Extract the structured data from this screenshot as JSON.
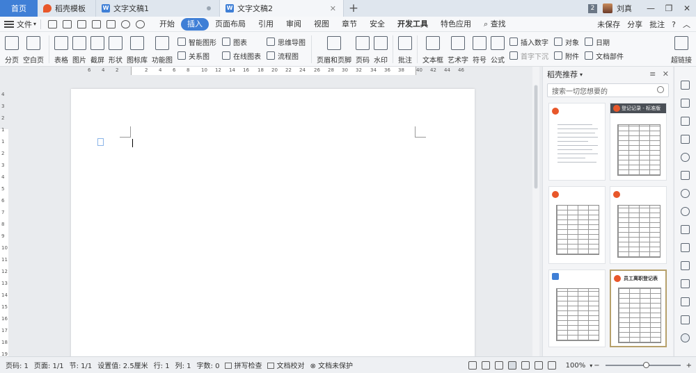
{
  "titlebar": {
    "home_tab": "首页",
    "tabs": [
      {
        "label": "稻壳模板"
      },
      {
        "label": "文字文稿1"
      },
      {
        "label": "文字文稿2"
      }
    ],
    "new_tab": "+",
    "badge": "2",
    "user_name": "刘真"
  },
  "menubar": {
    "file": "文件",
    "items": [
      "开始",
      "插入",
      "页面布局",
      "引用",
      "审阅",
      "视图",
      "章节",
      "安全",
      "开发工具",
      "特色应用",
      "查找"
    ],
    "active": "插入",
    "right": {
      "unsaved": "未保存",
      "share": "分享",
      "comment": "批注",
      "help": "?"
    }
  },
  "ribbon": {
    "page_break": "分页",
    "blank_page": "空白页",
    "table": "表格",
    "picture": "图片",
    "screenshot": "截屏",
    "shape": "形状",
    "icon_lib": "图标库",
    "func_chart": "功能图",
    "smart_shape": "智能图形",
    "chart": "图表",
    "mind_map": "思维导图",
    "relation": "关系图",
    "online_chart": "在线图表",
    "flowchart": "流程图",
    "header_footer": "页眉和页脚",
    "page_num": "页码",
    "watermark": "水印",
    "comment": "批注",
    "text_box": "文本框",
    "word_art": "艺术字",
    "symbol": "符号",
    "formula": "公式",
    "insert_number": "插入数字",
    "object": "对象",
    "date": "日期",
    "drop_cap": "首字下沉",
    "attachment": "附件",
    "doc_parts": "文档部件",
    "hyperlink": "超链接"
  },
  "ruler": {
    "h_ticks": [
      "6",
      "4",
      "2",
      "2",
      "4",
      "6",
      "8",
      "10",
      "12",
      "14",
      "16",
      "18",
      "20",
      "22",
      "24",
      "26",
      "28",
      "30",
      "32",
      "34",
      "36",
      "38",
      "40",
      "42",
      "44",
      "46"
    ],
    "v_ticks": [
      "4",
      "3",
      "2",
      "1",
      "1",
      "2",
      "3",
      "4",
      "5",
      "6",
      "7",
      "8",
      "9",
      "10",
      "11",
      "12",
      "13",
      "14",
      "15",
      "16",
      "17",
      "18",
      "19",
      "20"
    ]
  },
  "panel": {
    "title": "稻壳推荐",
    "search_placeholder": "搜索一切您想要的",
    "thumbs": [
      {
        "title": ""
      },
      {
        "title": "登记记录 - 标准版"
      },
      {
        "title": ""
      },
      {
        "title": ""
      },
      {
        "title": ""
      },
      {
        "title": "员工离职登记表"
      }
    ]
  },
  "statusbar": {
    "page_num": "页码: 1",
    "pages": "页面: 1/1",
    "section": "节: 1/1",
    "setting": "设置值: 2.5厘米",
    "row": "行: 1",
    "col": "列: 1",
    "words": "字数: 0",
    "spell": "拼写检查",
    "proof": "文档校对",
    "protect": "文档未保护",
    "zoom": "100%",
    "zoom_minus": "−",
    "zoom_plus": "+"
  },
  "colors": {
    "accent": "#3f7fd6",
    "daoke": "#e8572a"
  }
}
